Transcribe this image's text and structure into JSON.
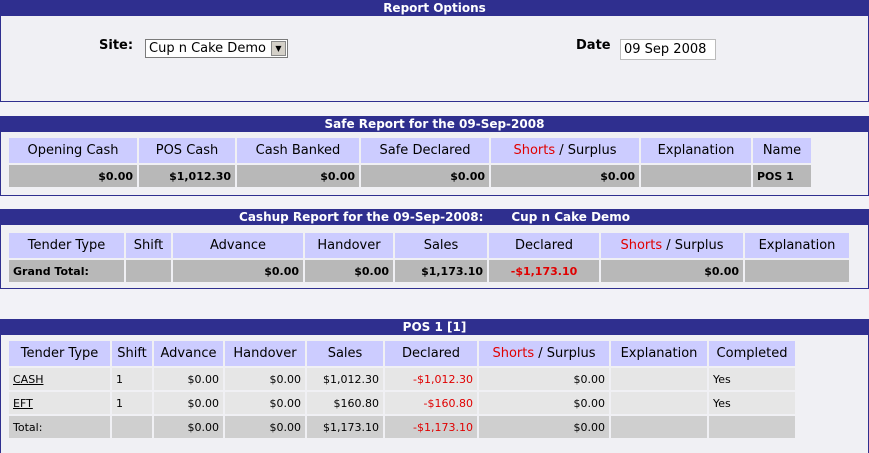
{
  "report_options": {
    "title": "Report Options",
    "site_label": "Site:",
    "site_value": "Cup n Cake Demo",
    "date_label": "Date",
    "date_value": "09 Sep 2008"
  },
  "safe_report": {
    "title": "Safe Report for the 09-Sep-2008",
    "headers": {
      "opening_cash": "Opening Cash",
      "pos_cash": "POS Cash",
      "cash_banked": "Cash Banked",
      "safe_declared": "Safe Declared",
      "shorts": "Shorts",
      "surplus": " / Surplus",
      "explanation": "Explanation",
      "name": "Name"
    },
    "row": {
      "opening_cash": "$0.00",
      "pos_cash": "$1,012.30",
      "cash_banked": "$0.00",
      "safe_declared": "$0.00",
      "shorts_surplus": "$0.00",
      "explanation": "",
      "name": "POS 1"
    }
  },
  "cashup_report": {
    "title": "Cashup Report for the 09-Sep-2008:",
    "site": "Cup n Cake Demo",
    "headers": {
      "tender_type": "Tender Type",
      "shift": "Shift",
      "advance": "Advance",
      "handover": "Handover",
      "sales": "Sales",
      "declared": "Declared",
      "shorts": "Shorts",
      "surplus": " / Surplus",
      "explanation": "Explanation"
    },
    "grand_total": {
      "label": "Grand Total:",
      "shift": "",
      "advance": "$0.00",
      "handover": "$0.00",
      "sales": "$1,173.10",
      "declared": "-$1,173.10",
      "shorts_surplus": "$0.00",
      "explanation": ""
    }
  },
  "pos": {
    "title": "POS 1 [1]",
    "headers": {
      "tender_type": "Tender Type",
      "shift": "Shift",
      "advance": "Advance",
      "handover": "Handover",
      "sales": "Sales",
      "declared": "Declared",
      "shorts": "Shorts",
      "surplus": " / Surplus",
      "explanation": "Explanation",
      "completed": "Completed"
    },
    "rows": [
      {
        "tender": "CASH",
        "shift": "1",
        "advance": "$0.00",
        "handover": "$0.00",
        "sales": "$1,012.30",
        "declared": "-$1,012.30",
        "shorts_surplus": "$0.00",
        "explanation": "",
        "completed": "Yes"
      },
      {
        "tender": "EFT",
        "shift": "1",
        "advance": "$0.00",
        "handover": "$0.00",
        "sales": "$160.80",
        "declared": "-$160.80",
        "shorts_surplus": "$0.00",
        "explanation": "",
        "completed": "Yes"
      }
    ],
    "total": {
      "label": "Total:",
      "shift": "",
      "advance": "$0.00",
      "handover": "$0.00",
      "sales": "$1,173.10",
      "declared": "-$1,173.10",
      "shorts_surplus": "$0.00",
      "explanation": "",
      "completed": ""
    }
  }
}
